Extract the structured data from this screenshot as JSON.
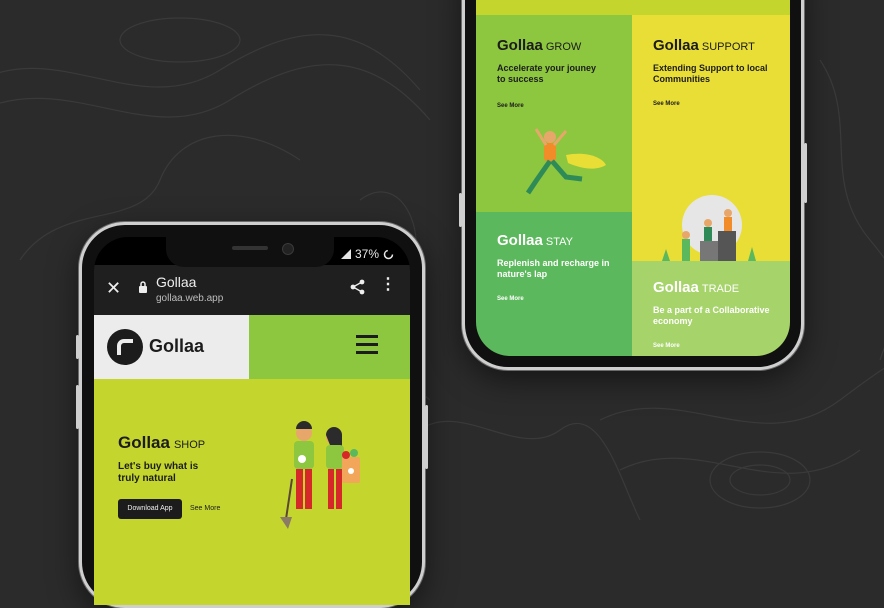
{
  "colors": {
    "background": "#2b2b2b",
    "green": "#8dc63f",
    "lime": "#c4d62e",
    "yellow": "#e9de36",
    "mid_green": "#5cb85c",
    "light_green": "#a6d36a"
  },
  "left_phone": {
    "status": {
      "battery": "37%"
    },
    "browser": {
      "title": "Gollaa",
      "url": "gollaa.web.app",
      "icons": [
        "close-icon",
        "lock-icon",
        "share-icon",
        "more-vertical-icon"
      ]
    },
    "site_header": {
      "logo_text": "Gollaa"
    },
    "hero": {
      "brand": "Gollaa",
      "section": "SHOP",
      "tagline": "Let's buy what is truly natural",
      "download_button": "Download App",
      "see_more": "See More"
    }
  },
  "right_phone": {
    "cards": {
      "grow": {
        "brand": "Gollaa",
        "section": "GROW",
        "tagline": "Accelerate your jouney to success",
        "see_more": "See More"
      },
      "support": {
        "brand": "Gollaa",
        "section": "SUPPORT",
        "tagline": "Extending Support to local Communities",
        "see_more": "See More"
      },
      "stay": {
        "brand": "Gollaa",
        "section": "STAY",
        "tagline": "Replenish and recharge in nature's lap",
        "see_more": "See More"
      },
      "trade": {
        "brand": "Gollaa",
        "section": "TRADE",
        "tagline": "Be a part of a Collaborative economy",
        "see_more": "See More"
      }
    }
  }
}
